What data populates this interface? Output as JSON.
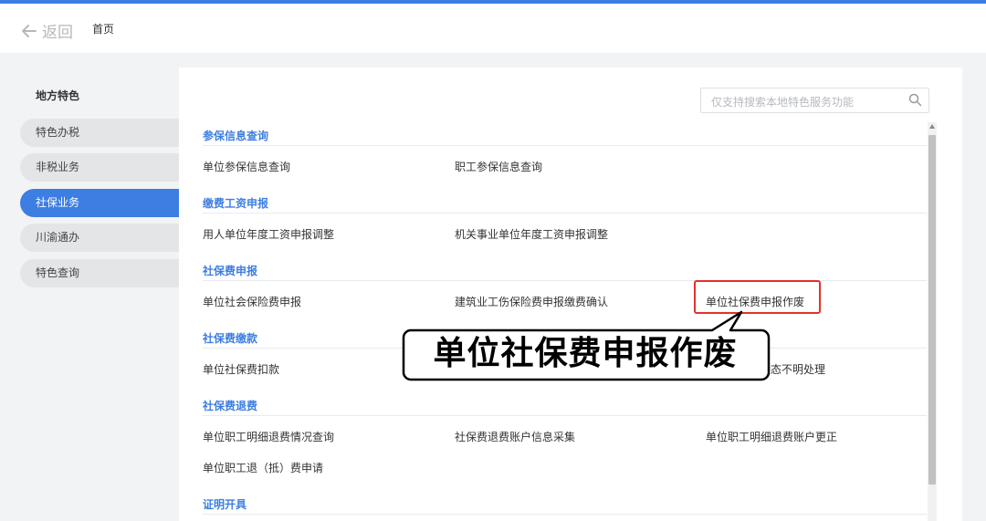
{
  "header": {
    "back_label": "返回",
    "home_label": "首页"
  },
  "sidebar": {
    "title": "地方特色",
    "items": [
      {
        "label": "特色办税"
      },
      {
        "label": "非税业务"
      },
      {
        "label": "社保业务",
        "active": true
      },
      {
        "label": "川渝通办"
      },
      {
        "label": "特色查询"
      }
    ]
  },
  "search": {
    "placeholder": "仅支持搜索本地特色服务功能"
  },
  "sections": [
    {
      "title": "参保信息查询",
      "links": [
        "单位参保信息查询",
        "职工参保信息查询"
      ]
    },
    {
      "title": "缴费工资申报",
      "links": [
        "用人单位年度工资申报调整",
        "机关事业单位年度工资申报调整"
      ]
    },
    {
      "title": "社保费申报",
      "links": [
        "单位社会保险费申报",
        "建筑业工伤保险费申报缴费确认",
        "单位社保费申报作废"
      ]
    },
    {
      "title": "社保费缴款",
      "links": [
        "单位社保费扣款",
        "状态不明处理"
      ]
    },
    {
      "title": "社保费退费",
      "links": [
        "单位职工明细退费情况查询",
        "社保费退费账户信息采集",
        "单位职工明细退费账户更正",
        "单位职工退（抵）费申请"
      ]
    },
    {
      "title": "证明开具",
      "links": []
    }
  ],
  "callout": {
    "text": "单位社保费申报作废"
  },
  "colors": {
    "accent": "#3d7ee3",
    "highlight": "#e2322a"
  }
}
